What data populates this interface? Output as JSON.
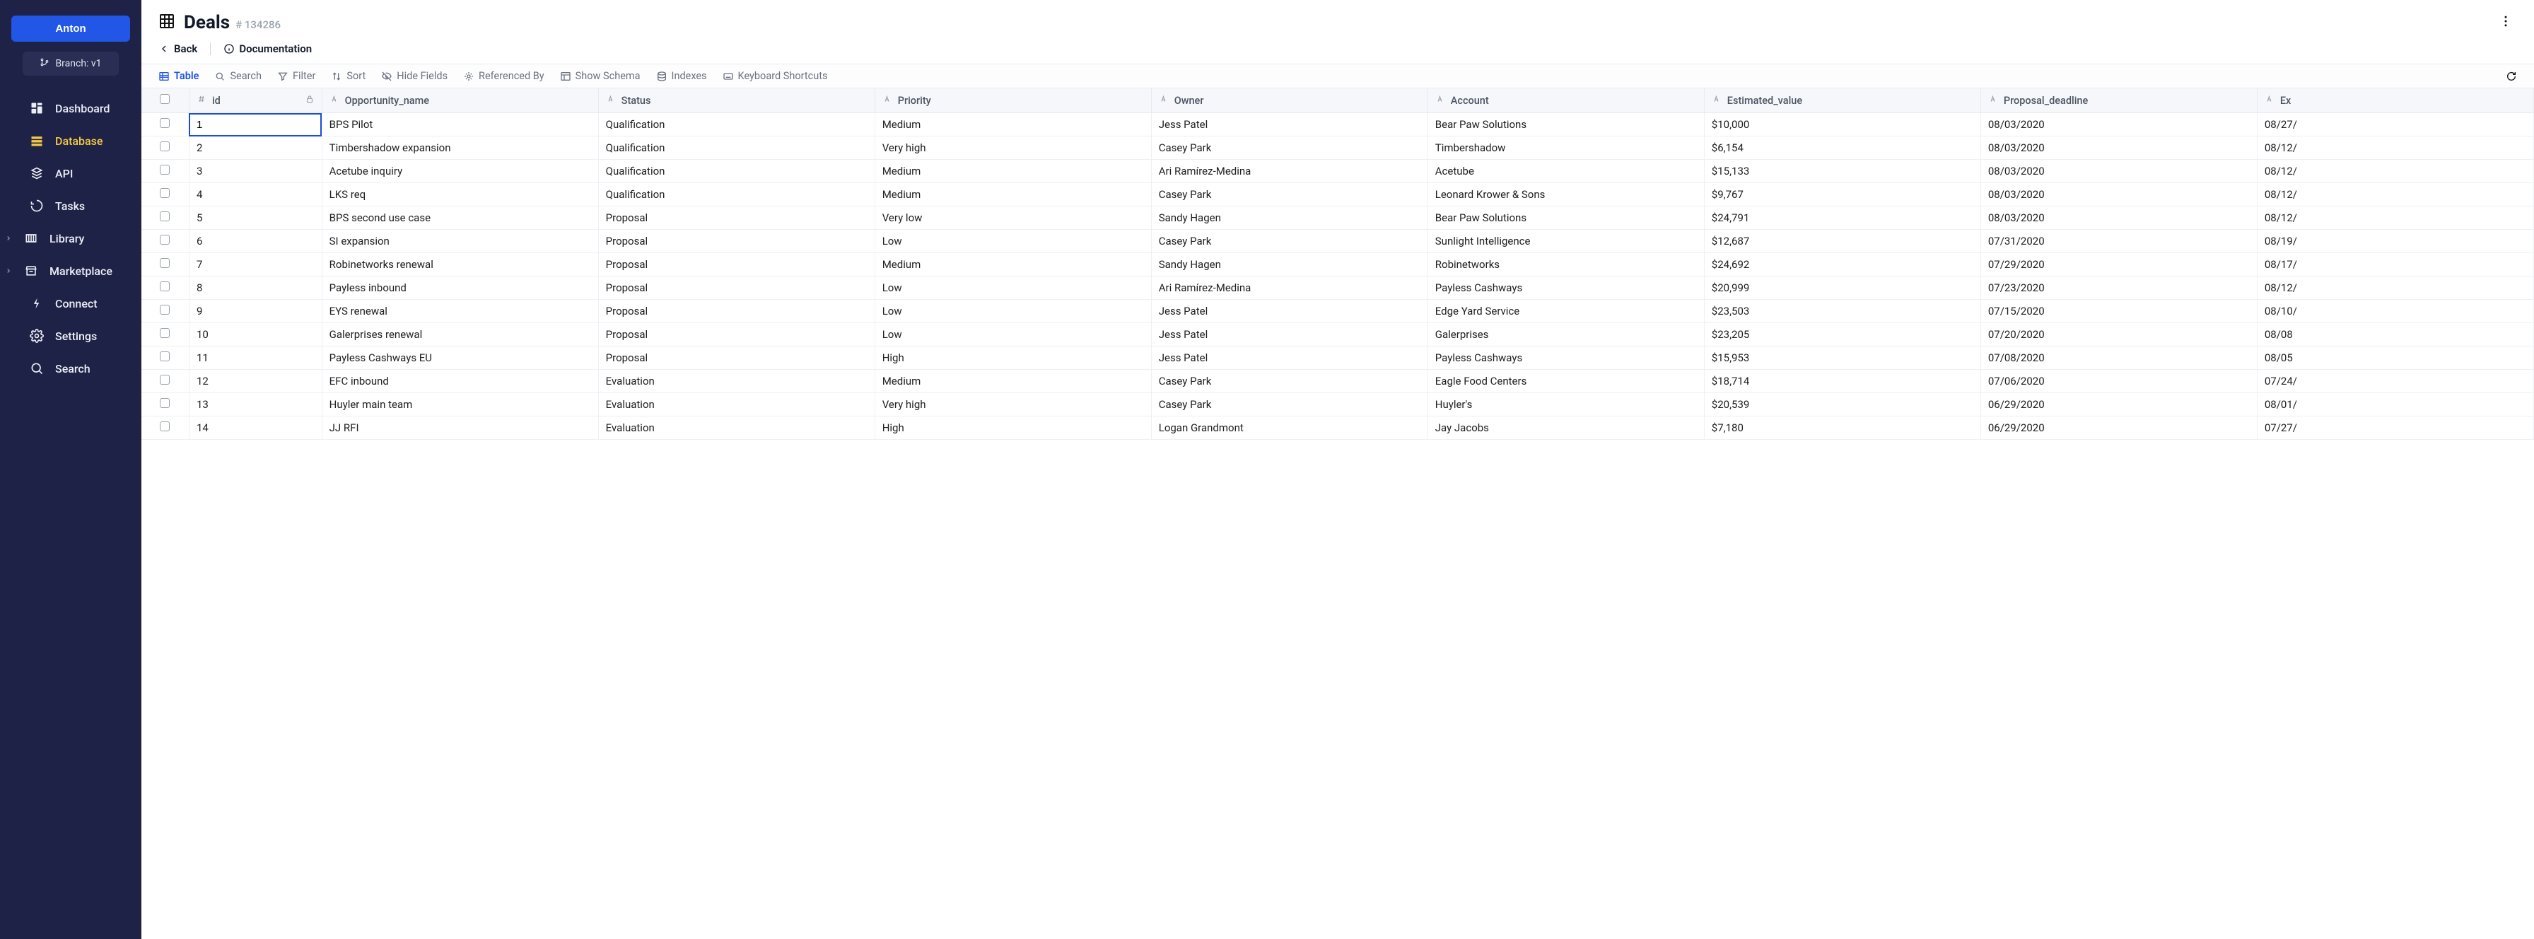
{
  "sidebar": {
    "primary_label": "Anton",
    "branch_label": "Branch: v1",
    "items": [
      {
        "key": "dashboard",
        "label": "Dashboard",
        "expandable": false
      },
      {
        "key": "database",
        "label": "Database",
        "expandable": false,
        "active": true
      },
      {
        "key": "api",
        "label": "API",
        "expandable": false
      },
      {
        "key": "tasks",
        "label": "Tasks",
        "expandable": false
      },
      {
        "key": "library",
        "label": "Library",
        "expandable": true
      },
      {
        "key": "marketplace",
        "label": "Marketplace",
        "expandable": true
      },
      {
        "key": "connect",
        "label": "Connect",
        "expandable": false
      },
      {
        "key": "settings",
        "label": "Settings",
        "expandable": false
      },
      {
        "key": "search",
        "label": "Search",
        "expandable": false
      }
    ]
  },
  "header": {
    "title": "Deals",
    "table_id": "# 134286"
  },
  "subheader": {
    "back": "Back",
    "docs": "Documentation"
  },
  "toolbar": {
    "table": "Table",
    "search": "Search",
    "filter": "Filter",
    "sort": "Sort",
    "hide_fields": "Hide Fields",
    "referenced_by": "Referenced By",
    "show_schema": "Show Schema",
    "indexes": "Indexes",
    "keyboard_shortcuts": "Keyboard Shortcuts"
  },
  "columns": [
    {
      "key": "id",
      "label": "id",
      "type": "number",
      "locked": true
    },
    {
      "key": "Opportunity_name",
      "label": "Opportunity_name",
      "type": "text"
    },
    {
      "key": "Status",
      "label": "Status",
      "type": "text"
    },
    {
      "key": "Priority",
      "label": "Priority",
      "type": "text"
    },
    {
      "key": "Owner",
      "label": "Owner",
      "type": "text"
    },
    {
      "key": "Account",
      "label": "Account",
      "type": "text"
    },
    {
      "key": "Estimated_value",
      "label": "Estimated_value",
      "type": "text"
    },
    {
      "key": "Proposal_deadline",
      "label": "Proposal_deadline",
      "type": "text"
    },
    {
      "key": "Expected_close",
      "label": "Ex",
      "type": "text"
    }
  ],
  "rows": [
    {
      "id": "1",
      "Opportunity_name": "BPS Pilot",
      "Status": "Qualification",
      "Priority": "Medium",
      "Owner": "Jess Patel",
      "Account": "Bear Paw Solutions",
      "Estimated_value": "$10,000",
      "Proposal_deadline": "08/03/2020",
      "Expected_close": "08/27/"
    },
    {
      "id": "2",
      "Opportunity_name": "Timbershadow expansion",
      "Status": "Qualification",
      "Priority": "Very high",
      "Owner": "Casey Park",
      "Account": "Timbershadow",
      "Estimated_value": "$6,154",
      "Proposal_deadline": "08/03/2020",
      "Expected_close": "08/12/"
    },
    {
      "id": "3",
      "Opportunity_name": "Acetube inquiry",
      "Status": "Qualification",
      "Priority": "Medium",
      "Owner": "Ari Ramírez-Medina",
      "Account": "Acetube",
      "Estimated_value": "$15,133",
      "Proposal_deadline": "08/03/2020",
      "Expected_close": "08/12/"
    },
    {
      "id": "4",
      "Opportunity_name": "LKS req",
      "Status": "Qualification",
      "Priority": "Medium",
      "Owner": "Casey Park",
      "Account": "Leonard Krower & Sons",
      "Estimated_value": "$9,767",
      "Proposal_deadline": "08/03/2020",
      "Expected_close": "08/12/"
    },
    {
      "id": "5",
      "Opportunity_name": "BPS second use case",
      "Status": "Proposal",
      "Priority": "Very low",
      "Owner": "Sandy Hagen",
      "Account": "Bear Paw Solutions",
      "Estimated_value": "$24,791",
      "Proposal_deadline": "08/03/2020",
      "Expected_close": "08/12/"
    },
    {
      "id": "6",
      "Opportunity_name": "SI expansion",
      "Status": "Proposal",
      "Priority": "Low",
      "Owner": "Casey Park",
      "Account": "Sunlight Intelligence",
      "Estimated_value": "$12,687",
      "Proposal_deadline": "07/31/2020",
      "Expected_close": "08/19/"
    },
    {
      "id": "7",
      "Opportunity_name": "Robinetworks renewal",
      "Status": "Proposal",
      "Priority": "Medium",
      "Owner": "Sandy Hagen",
      "Account": "Robinetworks",
      "Estimated_value": "$24,692",
      "Proposal_deadline": "07/29/2020",
      "Expected_close": "08/17/"
    },
    {
      "id": "8",
      "Opportunity_name": "Payless inbound",
      "Status": "Proposal",
      "Priority": "Low",
      "Owner": "Ari Ramírez-Medina",
      "Account": "Payless Cashways",
      "Estimated_value": "$20,999",
      "Proposal_deadline": "07/23/2020",
      "Expected_close": "08/12/"
    },
    {
      "id": "9",
      "Opportunity_name": "EYS renewal",
      "Status": "Proposal",
      "Priority": "Low",
      "Owner": "Jess Patel",
      "Account": "Edge Yard Service",
      "Estimated_value": "$23,503",
      "Proposal_deadline": "07/15/2020",
      "Expected_close": "08/10/"
    },
    {
      "id": "10",
      "Opportunity_name": "Galerprises renewal",
      "Status": "Proposal",
      "Priority": "Low",
      "Owner": "Jess Patel",
      "Account": "Galerprises",
      "Estimated_value": "$23,205",
      "Proposal_deadline": "07/20/2020",
      "Expected_close": "08/08"
    },
    {
      "id": "11",
      "Opportunity_name": "Payless Cashways EU",
      "Status": "Proposal",
      "Priority": "High",
      "Owner": "Jess Patel",
      "Account": "Payless Cashways",
      "Estimated_value": "$15,953",
      "Proposal_deadline": "07/08/2020",
      "Expected_close": "08/05"
    },
    {
      "id": "12",
      "Opportunity_name": "EFC inbound",
      "Status": "Evaluation",
      "Priority": "Medium",
      "Owner": "Casey Park",
      "Account": "Eagle Food Centers",
      "Estimated_value": "$18,714",
      "Proposal_deadline": "07/06/2020",
      "Expected_close": "07/24/"
    },
    {
      "id": "13",
      "Opportunity_name": "Huyler main team",
      "Status": "Evaluation",
      "Priority": "Very high",
      "Owner": "Casey Park",
      "Account": "Huyler's",
      "Estimated_value": "$20,539",
      "Proposal_deadline": "06/29/2020",
      "Expected_close": "08/01/"
    },
    {
      "id": "14",
      "Opportunity_name": "JJ RFI",
      "Status": "Evaluation",
      "Priority": "High",
      "Owner": "Logan Grandmont",
      "Account": "Jay Jacobs",
      "Estimated_value": "$7,180",
      "Proposal_deadline": "06/29/2020",
      "Expected_close": "07/27/"
    }
  ],
  "selected_row": 0
}
